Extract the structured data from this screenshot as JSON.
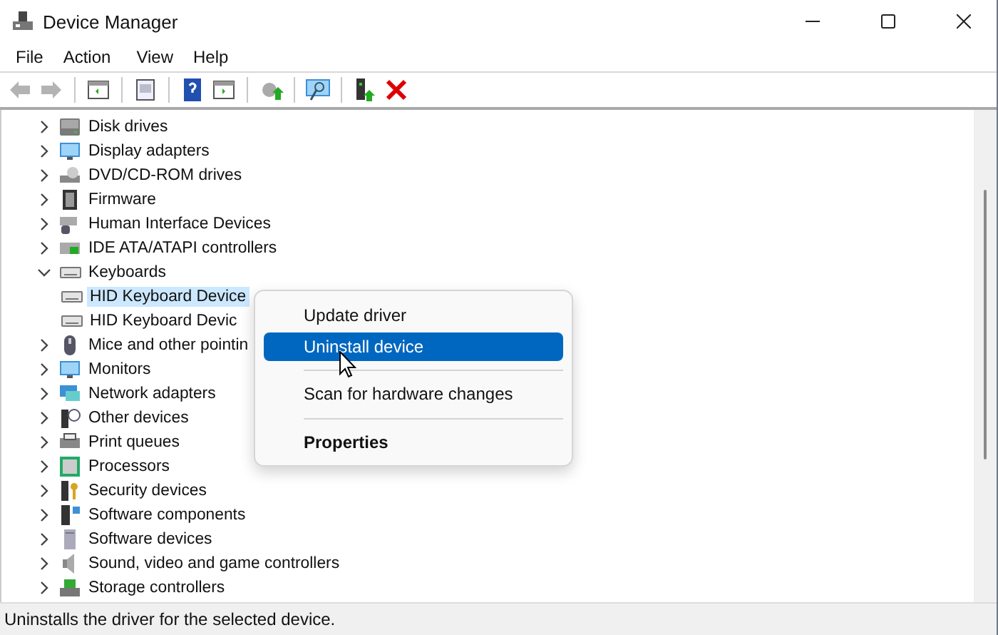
{
  "window": {
    "title": "Device Manager"
  },
  "menu_bar": [
    {
      "label": "File"
    },
    {
      "label": "Action"
    },
    {
      "label": "View"
    },
    {
      "label": "Help"
    }
  ],
  "toolbar": [
    {
      "kind": "back",
      "disabled": true
    },
    {
      "kind": "forward",
      "disabled": true
    },
    {
      "kind": "separator"
    },
    {
      "kind": "console",
      "disabled": false
    },
    {
      "kind": "separator"
    },
    {
      "kind": "properties",
      "disabled": false
    },
    {
      "kind": "separator"
    },
    {
      "kind": "help",
      "disabled": false
    },
    {
      "kind": "panel",
      "disabled": false
    },
    {
      "kind": "separator"
    },
    {
      "kind": "update",
      "disabled": false
    },
    {
      "kind": "separator"
    },
    {
      "kind": "scan",
      "disabled": false
    },
    {
      "kind": "separator"
    },
    {
      "kind": "enable",
      "disabled": false
    },
    {
      "kind": "remove",
      "disabled": false
    }
  ],
  "tree": [
    {
      "label": "Disk drives",
      "kind": "disk",
      "expanded": false,
      "selected": false
    },
    {
      "label": "Display adapters",
      "kind": "display",
      "expanded": false,
      "selected": false
    },
    {
      "label": "DVD/CD-ROM drives",
      "kind": "dvd",
      "expanded": false,
      "selected": false
    },
    {
      "label": "Firmware",
      "kind": "chip",
      "expanded": false,
      "selected": false
    },
    {
      "label": "Human Interface Devices",
      "kind": "hid",
      "expanded": false,
      "selected": false
    },
    {
      "label": "IDE ATA/ATAPI controllers",
      "kind": "card",
      "expanded": false,
      "selected": false
    },
    {
      "label": "Keyboards",
      "kind": "keyboard",
      "expanded": true,
      "selected": false,
      "children": [
        {
          "label": "HID Keyboard Device",
          "kind": "keyboard",
          "selected": true
        },
        {
          "label": "HID Keyboard Devic",
          "kind": "keyboard",
          "selected": false
        }
      ]
    },
    {
      "label": "Mice and other pointin",
      "kind": "mouse",
      "expanded": false,
      "selected": false
    },
    {
      "label": "Monitors",
      "kind": "display",
      "expanded": false,
      "selected": false
    },
    {
      "label": "Network adapters",
      "kind": "network",
      "expanded": false,
      "selected": false
    },
    {
      "label": "Other devices",
      "kind": "other",
      "expanded": false,
      "selected": false
    },
    {
      "label": "Print queues",
      "kind": "printer",
      "expanded": false,
      "selected": false
    },
    {
      "label": "Processors",
      "kind": "cpu",
      "expanded": false,
      "selected": false
    },
    {
      "label": "Security devices",
      "kind": "security",
      "expanded": false,
      "selected": false
    },
    {
      "label": "Software components",
      "kind": "component",
      "expanded": false,
      "selected": false
    },
    {
      "label": "Software devices",
      "kind": "tower",
      "expanded": false,
      "selected": false
    },
    {
      "label": "Sound, video and game controllers",
      "kind": "speaker",
      "expanded": false,
      "selected": false
    },
    {
      "label": "Storage controllers",
      "kind": "storage",
      "expanded": false,
      "selected": false
    }
  ],
  "context_menu": [
    {
      "kind": "item",
      "label": "Update driver",
      "selected": false,
      "default": false
    },
    {
      "kind": "item",
      "label": "Uninstall device",
      "selected": true,
      "default": false
    },
    {
      "kind": "separator"
    },
    {
      "kind": "item",
      "label": "Scan for hardware changes",
      "selected": false,
      "default": false
    },
    {
      "kind": "separator"
    },
    {
      "kind": "item",
      "label": "Properties",
      "selected": false,
      "default": true
    }
  ],
  "status_bar": {
    "text": "Uninstalls the driver for the selected device."
  }
}
